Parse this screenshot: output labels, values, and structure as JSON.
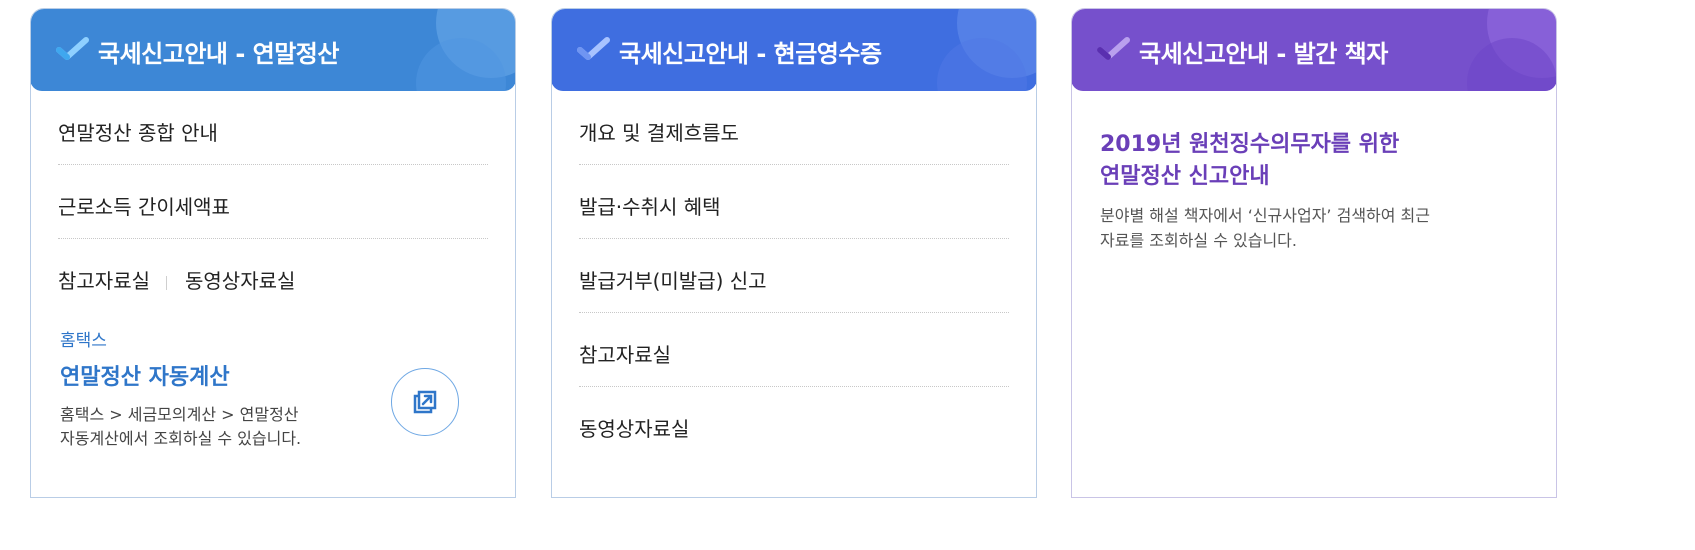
{
  "cards": [
    {
      "title": "국세신고안내 - 연말정산",
      "menu": [
        "연말정산 종합 안내",
        "근로소득 간이세액표"
      ],
      "links_row": [
        "참고자료실",
        "동영상자료실"
      ],
      "hometax": {
        "label": "홈택스",
        "title": "연말정산 자동계산",
        "desc_line1": "홈택스 > 세금모의계산 > 연말정산",
        "desc_line2": "자동계산에서 조회하실 수 있습니다."
      },
      "accent": "#3d87d6"
    },
    {
      "title": "국세신고안내 - 현금영수증",
      "menu": [
        "개요 및 결제흐름도",
        "발급·수취시 혜택",
        "발급거부(미발급) 신고",
        "참고자료실",
        "동영상자료실"
      ],
      "accent": "#3f6ee0"
    },
    {
      "title": "국세신고안내 - 발간 책자",
      "book": {
        "title_line1": "2019년 원천징수의무자를 위한",
        "title_line2": "연말정산 신고안내",
        "desc_line1": "분야별 해설 책자에서 ‘신규사업자’ 검색하여 최근",
        "desc_line2": "자료를 조회하실 수 있습니다."
      },
      "accent": "#7650cc"
    }
  ],
  "icons": {
    "check": "check-icon",
    "external": "external-link-icon"
  }
}
